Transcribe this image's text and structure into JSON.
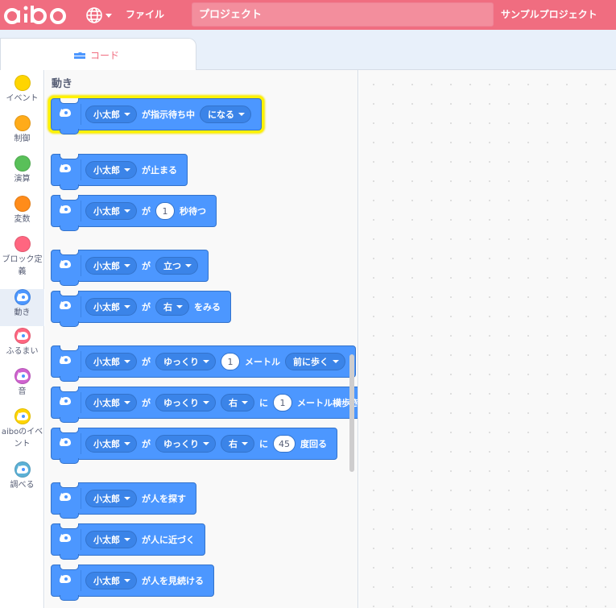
{
  "header": {
    "logo": "aibo",
    "file_menu": "ファイル",
    "project_placeholder": "プロジェクト",
    "sample_menu": "サンプルプロジェクト",
    "colors": {
      "bar": "#f06d80",
      "input": "#f38e9d"
    }
  },
  "tabs": [
    {
      "label": "コード",
      "icon": "code-icon"
    }
  ],
  "categories": [
    {
      "label": "イベント",
      "color": "#ffd500"
    },
    {
      "label": "制御",
      "color": "#ffab19"
    },
    {
      "label": "演算",
      "color": "#59c059"
    },
    {
      "label": "変数",
      "color": "#ff8c1a"
    },
    {
      "label": "ブロック定義",
      "color": "#ff6680"
    },
    {
      "label": "動き",
      "color": "#4c97ff",
      "icon": "aibo-icon"
    },
    {
      "label": "ふるまい",
      "color": "#ff6680",
      "icon": "aibo-icon"
    },
    {
      "label": "音",
      "color": "#cf63cf",
      "icon": "aibo-icon"
    },
    {
      "label": "aiboのイベント",
      "color": "#ffd500",
      "icon": "aibo-icon"
    },
    {
      "label": "調べる",
      "color": "#5cb1d6",
      "icon": "aibo-icon"
    }
  ],
  "flyout": {
    "heading": "動き",
    "blocks": [
      {
        "parts": [
          {
            "drop": "小太郎"
          },
          {
            "text": "が指示待ち中"
          },
          {
            "drop": "になる"
          }
        ]
      },
      {
        "parts": [
          {
            "drop": "小太郎"
          },
          {
            "text": "が止まる"
          }
        ]
      },
      {
        "parts": [
          {
            "drop": "小太郎"
          },
          {
            "text": "が"
          },
          {
            "num": "1"
          },
          {
            "text": "秒待つ"
          }
        ]
      },
      {
        "parts": [
          {
            "drop": "小太郎"
          },
          {
            "text": "が"
          },
          {
            "drop": "立つ"
          }
        ]
      },
      {
        "parts": [
          {
            "drop": "小太郎"
          },
          {
            "text": "が"
          },
          {
            "drop": "右"
          },
          {
            "text": "をみる"
          }
        ]
      },
      {
        "parts": [
          {
            "drop": "小太郎"
          },
          {
            "text": "が"
          },
          {
            "drop": "ゆっくり"
          },
          {
            "num": "1"
          },
          {
            "text": "メートル"
          },
          {
            "drop": "前に歩く"
          }
        ]
      },
      {
        "parts": [
          {
            "drop": "小太郎"
          },
          {
            "text": "が"
          },
          {
            "drop": "ゆっくり"
          },
          {
            "drop": "右"
          },
          {
            "text": "に"
          },
          {
            "num": "1"
          },
          {
            "text": "メートル横歩き"
          }
        ]
      },
      {
        "parts": [
          {
            "drop": "小太郎"
          },
          {
            "text": "が"
          },
          {
            "drop": "ゆっくり"
          },
          {
            "drop": "右"
          },
          {
            "text": "に"
          },
          {
            "num": "45"
          },
          {
            "text": "度回る"
          }
        ]
      },
      {
        "parts": [
          {
            "drop": "小太郎"
          },
          {
            "text": "が人を探す"
          }
        ]
      },
      {
        "parts": [
          {
            "drop": "小太郎"
          },
          {
            "text": "が人に近づく"
          }
        ]
      },
      {
        "parts": [
          {
            "drop": "小太郎"
          },
          {
            "text": "が人を見続ける"
          }
        ]
      }
    ]
  }
}
